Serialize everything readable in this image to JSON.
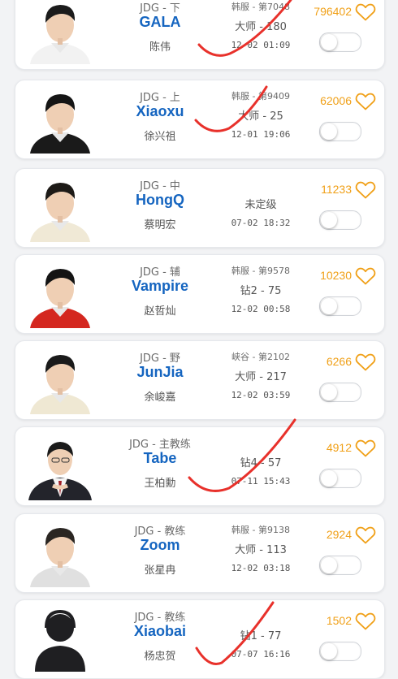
{
  "colors": {
    "team_text": "#6b6b6b",
    "player_name": "#1565c0",
    "likes": "#f0a018",
    "heart_outline": "#f0a018",
    "check_mark": "#e8312b"
  },
  "players": [
    {
      "team": "JDG - 下",
      "name": "GALA",
      "realname": "陈伟",
      "server": "韩服 - 第7048",
      "rank": "大师 - 180",
      "time": "12-02 01:09",
      "likes": "796402",
      "avatar_icon": "player-photo",
      "toggle_on": false
    },
    {
      "team": "JDG - 上",
      "name": "Xiaoxu",
      "realname": "徐兴祖",
      "server": "韩服 - 第9409",
      "rank": "大师 - 25",
      "time": "12-01 19:06",
      "likes": "62006",
      "avatar_icon": "player-photo",
      "toggle_on": false
    },
    {
      "team": "JDG - 中",
      "name": "HongQ",
      "realname": "蔡明宏",
      "server": "",
      "rank": "未定级",
      "time": "07-02 18:32",
      "likes": "11233",
      "avatar_icon": "player-photo",
      "toggle_on": false
    },
    {
      "team": "JDG - 辅",
      "name": "Vampire",
      "realname": "赵哲灿",
      "server": "韩服 - 第9578",
      "rank": "钻2 - 75",
      "time": "12-02 00:58",
      "likes": "10230",
      "avatar_icon": "player-photo",
      "toggle_on": false
    },
    {
      "team": "JDG - 野",
      "name": "JunJia",
      "realname": "余峻嘉",
      "server": "峡谷 - 第2102",
      "rank": "大师 - 217",
      "time": "12-02 03:59",
      "likes": "6266",
      "avatar_icon": "player-photo",
      "toggle_on": false
    },
    {
      "team": "JDG - 主教练",
      "name": "Tabe",
      "realname": "王柏勳",
      "server": "",
      "rank": "钻4 - 57",
      "time": "07-11 15:43",
      "likes": "4912",
      "avatar_icon": "coach-photo",
      "toggle_on": false
    },
    {
      "team": "JDG - 教练",
      "name": "Zoom",
      "realname": "张星冉",
      "server": "韩服 - 第9138",
      "rank": "大师 - 113",
      "time": "12-02 03:18",
      "likes": "2924",
      "avatar_icon": "player-photo",
      "toggle_on": false
    },
    {
      "team": "JDG - 教练",
      "name": "Xiaobai",
      "realname": "杨忠贺",
      "server": "",
      "rank": "钻1 - 77",
      "time": "07-07 16:16",
      "likes": "1502",
      "avatar_icon": "default-user-silhouette",
      "toggle_on": false
    }
  ],
  "annotations": {
    "mark_icon": "red-check-mark",
    "marked_cards": [
      0,
      1,
      5,
      7
    ]
  }
}
